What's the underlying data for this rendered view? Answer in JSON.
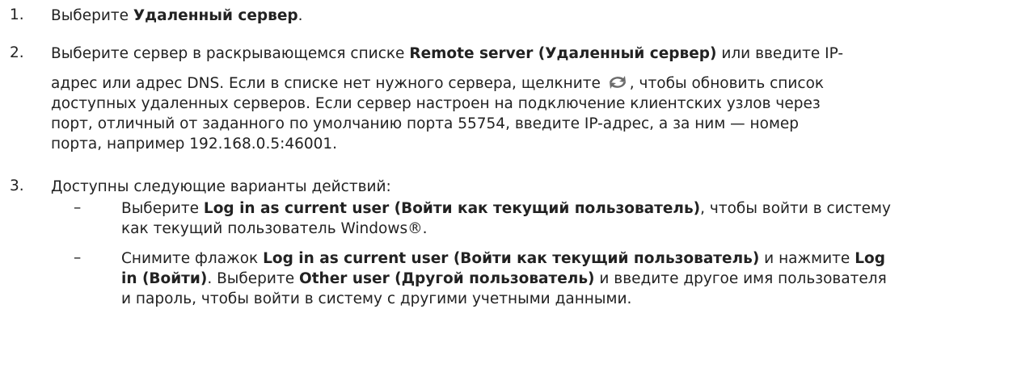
{
  "steps": [
    {
      "number": "1.",
      "text_before": "Выберите ",
      "bold": "Удаленный сервер",
      "text_after": "."
    },
    {
      "number": "2.",
      "line1_before": "Выберите сервер в раскрывающемся списке ",
      "line1_bold": "Remote server (Удаленный сервер)",
      "line1_after": " или введите IP-",
      "line2_before": "адрес или адрес DNS. Если в списке нет нужного сервера, щелкните ",
      "line2_after": ", чтобы обновить список",
      "line3": "доступных удаленных серверов. Если сервер настроен на подключение клиентских узлов через",
      "line4": "порт, отличный от заданного по умолчанию порта 55754, введите IP-адрес, а за ним — номер",
      "line5": "порта, например 192.168.0.5:46001.",
      "icon": "refresh-icon"
    },
    {
      "number": "3.",
      "intro": "Доступны следующие варианты действий:",
      "options": [
        {
          "dash": "–",
          "a_before": "Выберите ",
          "a_bold": "Log in as current user (Войти как текущий пользователь)",
          "a_after": ", чтобы войти в систему",
          "b": "как текущий пользователь Windows®."
        },
        {
          "dash": "–",
          "a_before": "Снимите флажок ",
          "a_bold1": "Log in as current user (Войти как текущий пользователь)",
          "a_mid": " и нажмите ",
          "a_bold2": "Log",
          "b_bold1": "in (Войти)",
          "b_mid": ". Выберите ",
          "b_bold2": "Other user (Другой пользователь)",
          "b_after": " и введите другое имя пользователя",
          "c": "и пароль, чтобы войти в систему с другими учетными данными."
        }
      ]
    }
  ],
  "colors": {
    "text": "#222222",
    "icon": "#6b6b6b"
  }
}
